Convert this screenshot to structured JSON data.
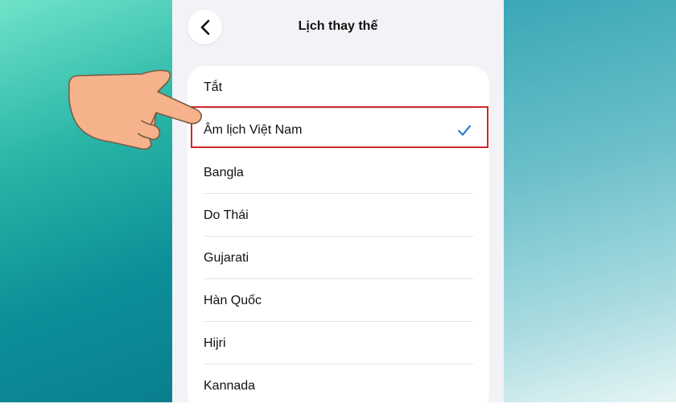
{
  "nav": {
    "title": "Lịch thay thế",
    "back_icon": "chevron-left-icon"
  },
  "options": [
    {
      "label": "Tắt",
      "selected": false
    },
    {
      "label": "Âm lịch Việt Nam",
      "selected": true
    },
    {
      "label": "Bangla",
      "selected": false
    },
    {
      "label": "Do Thái",
      "selected": false
    },
    {
      "label": "Gujarati",
      "selected": false
    },
    {
      "label": "Hàn Quốc",
      "selected": false
    },
    {
      "label": "Hijri",
      "selected": false
    },
    {
      "label": "Kannada",
      "selected": false
    }
  ],
  "colors": {
    "accent": "#2f7fd1",
    "highlight_border": "#d0282e",
    "background": "#f2f2f7"
  }
}
